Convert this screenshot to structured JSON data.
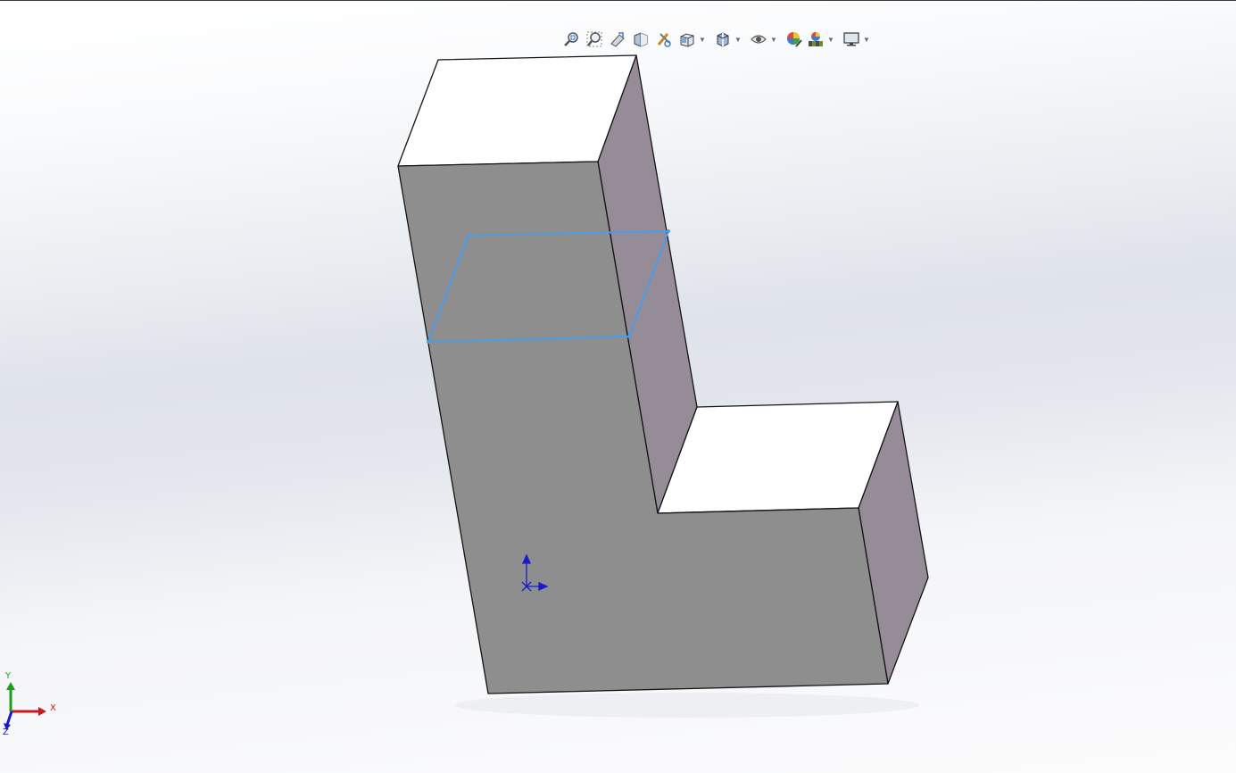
{
  "viewport": {
    "background_top": "#ffffff",
    "background_mid": "#dfe3ea",
    "part_front_color": "#8e8e8e",
    "part_side_color": "#968c98",
    "part_top_color": "#ffffff",
    "sketch_color": "#4a9be8",
    "origin_color": "#1a1acc"
  },
  "heads_up_toolbar": {
    "items": [
      {
        "name": "zoom-to-fit",
        "icon": "zoom-to-fit-icon",
        "dropdown": false
      },
      {
        "name": "zoom-to-area",
        "icon": "zoom-to-area-icon",
        "dropdown": false
      },
      {
        "name": "previous-view",
        "icon": "previous-view-icon",
        "dropdown": false
      },
      {
        "name": "section-view",
        "icon": "section-view-icon",
        "dropdown": false
      },
      {
        "name": "dynamic-annotation-views",
        "icon": "dynamic-annotation-icon",
        "dropdown": false
      },
      {
        "name": "view-orientation",
        "icon": "view-orientation-icon",
        "dropdown": true
      },
      {
        "name": "display-style",
        "icon": "display-style-icon",
        "dropdown": true
      },
      {
        "name": "hide-show-items",
        "icon": "hide-show-eye-icon",
        "dropdown": true
      },
      {
        "name": "edit-appearance",
        "icon": "edit-appearance-icon",
        "dropdown": false
      },
      {
        "name": "apply-scene",
        "icon": "apply-scene-icon",
        "dropdown": true
      },
      {
        "name": "view-settings",
        "icon": "monitor-icon",
        "dropdown": true
      }
    ]
  },
  "triad": {
    "x_label": "X",
    "y_label": "Y",
    "z_label": "Z",
    "x_color": "#cc1a1a",
    "y_color": "#1aa01a",
    "z_color": "#1a1acc"
  }
}
